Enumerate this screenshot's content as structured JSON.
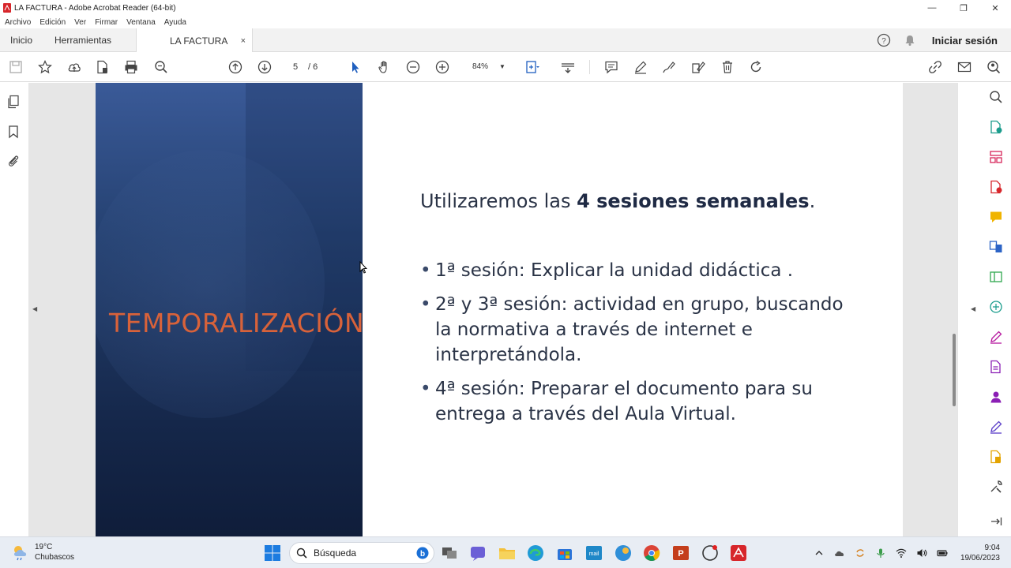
{
  "window": {
    "title": "LA FACTURA - Adobe Acrobat Reader (64-bit)",
    "minimize": "—",
    "restore": "❐",
    "close": "✕"
  },
  "menu": [
    "Archivo",
    "Edición",
    "Ver",
    "Firmar",
    "Ventana",
    "Ayuda"
  ],
  "tabs": {
    "home": "Inicio",
    "tools": "Herramientas",
    "document": "LA FACTURA",
    "close": "×",
    "signin": "Iniciar sesión"
  },
  "toolbar": {
    "current_page": "5",
    "page_separator": "/ 6",
    "zoom": "84%"
  },
  "slide": {
    "title": "TEMPORALIZACIÓN",
    "intro_start": "Utilizaremos las ",
    "intro_bold": "4 sesiones semanales",
    "intro_end": ".",
    "bullets": [
      "1ª sesión: Explicar la unidad didáctica .",
      "2ª y 3ª sesión: actividad en grupo, buscando la normativa a través de internet e interpretándola.",
      "4ª sesión: Preparar el documento para su entrega a través del Aula Virtual."
    ]
  },
  "taskbar": {
    "temperature": "19°C",
    "weather": "Chubascos",
    "search": "Búsqueda",
    "time": "9:04",
    "date": "19/06/2023"
  },
  "colors": {
    "accent_orange": "#d8623a",
    "slide_blue_top": "#3a5a98",
    "slide_blue_bottom": "#0f1d3a",
    "acrobat_red": "#d7262b"
  }
}
